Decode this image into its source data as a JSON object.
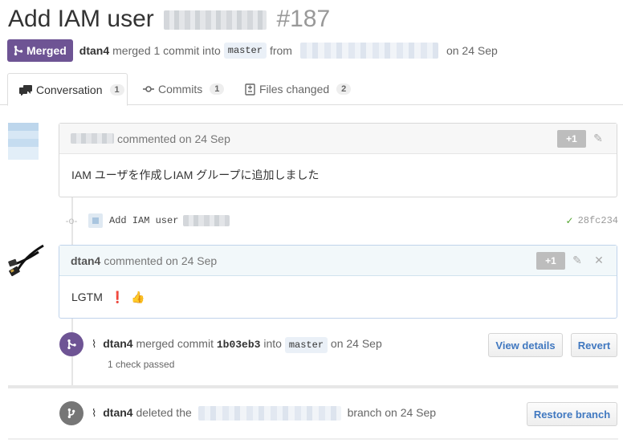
{
  "pr": {
    "title": "Add IAM user",
    "number": "#187",
    "state_label": "Merged",
    "author": "dtan4",
    "merge_text": "merged 1 commit into",
    "base_branch": "master",
    "from_text": "from",
    "date_text": "on 24 Sep"
  },
  "tabs": [
    {
      "label": "Conversation",
      "count": "1",
      "icon": "comment-discussion-icon"
    },
    {
      "label": "Commits",
      "count": "1",
      "icon": "git-commit-icon"
    },
    {
      "label": "Files changed",
      "count": "2",
      "icon": "diff-icon"
    }
  ],
  "comment1": {
    "action": "commented on 24 Sep",
    "plus_one": "+1",
    "body": "IAM ユーザを作成しIAM グループに追加しました"
  },
  "commit": {
    "message": "Add IAM user",
    "sha": "28fc234"
  },
  "comment2": {
    "author": "dtan4",
    "action": "commented on 24 Sep",
    "plus_one": "+1",
    "body": "LGTM",
    "emoji_exclaim": "❗",
    "emoji_thumbs": "👍"
  },
  "merge_event": {
    "author": "dtan4",
    "text": "merged commit",
    "sha": "1b03eb3",
    "into": "into",
    "branch": "master",
    "date": "on 24 Sep",
    "checks": "1 check passed",
    "view_details": "View details",
    "revert": "Revert"
  },
  "delete_event": {
    "author": "dtan4",
    "text": "deleted the",
    "suffix": "branch on 24 Sep",
    "restore": "Restore branch"
  },
  "colors": {
    "merged": "#6e5494",
    "link": "#4078c0",
    "success": "#55a532"
  }
}
